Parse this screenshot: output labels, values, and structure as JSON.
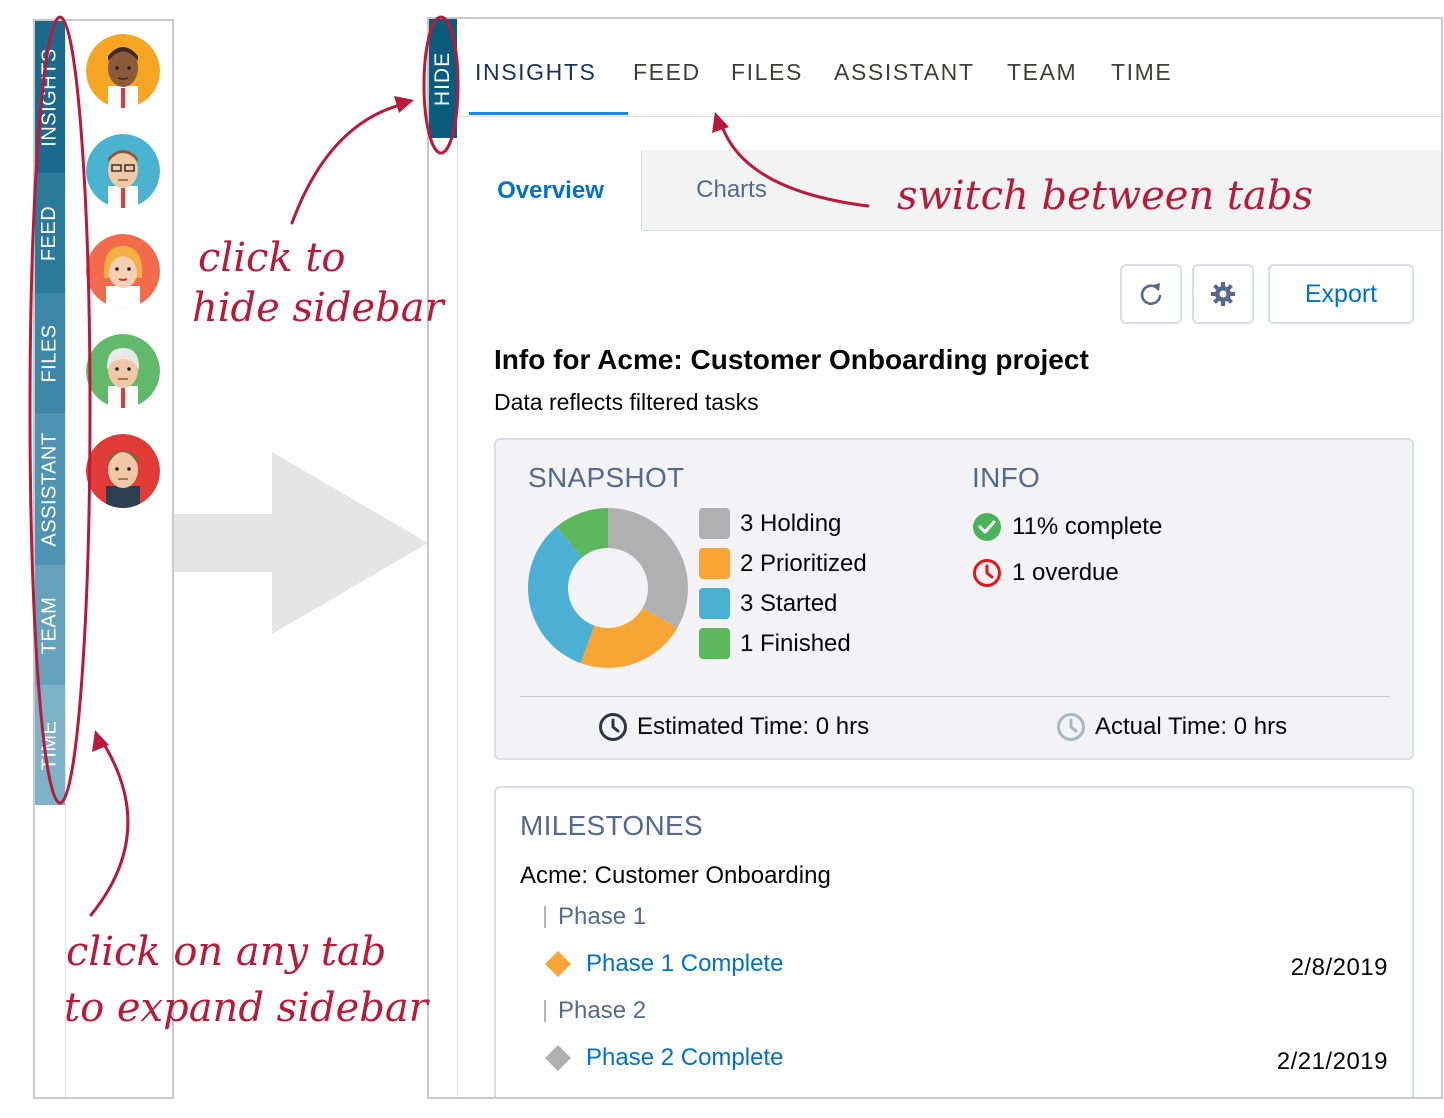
{
  "sidebar_collapsed": {
    "tabs": [
      {
        "label": "INSIGHTS",
        "color": "#1b6a8d"
      },
      {
        "label": "FEED",
        "color": "#2b7a9c"
      },
      {
        "label": "FILES",
        "color": "#3c87a7"
      },
      {
        "label": "ASSISTANT",
        "color": "#4e94b2"
      },
      {
        "label": "TEAM",
        "color": "#65a3bd"
      },
      {
        "label": "TIME",
        "color": "#7db2c8"
      }
    ],
    "avatars": [
      {
        "name": "avatar",
        "bg": "#f6a623",
        "skin": "#8a5a3b",
        "hair": "#3b2a20"
      },
      {
        "name": "avatar",
        "bg": "#4bb3d1",
        "skin": "#f1c9a5",
        "hair": "#8a5a3b"
      },
      {
        "name": "avatar",
        "bg": "#f26b4c",
        "skin": "#f5d0b5",
        "hair": "#f5b041"
      },
      {
        "name": "avatar",
        "bg": "#62b96c",
        "skin": "#f0c8a8",
        "hair": "#e8e8e8"
      },
      {
        "name": "avatar",
        "bg": "#e03b36",
        "skin": "#f0c8a8",
        "hair": "#8b5e3c"
      }
    ]
  },
  "expanded": {
    "hide_label": "HIDE",
    "tabs": [
      "INSIGHTS",
      "FEED",
      "FILES",
      "ASSISTANT",
      "TEAM",
      "TIME"
    ],
    "active_tab": "INSIGHTS",
    "subtabs": {
      "overview": "Overview",
      "charts": "Charts"
    },
    "toolbar": {
      "refresh_icon": "refresh-icon",
      "settings_icon": "gear-icon",
      "export_label": "Export"
    },
    "title": "Info for Acme: Customer Onboarding project",
    "subtitle": "Data reflects filtered tasks",
    "snapshot": {
      "heading": "SNAPSHOT",
      "legend": [
        {
          "label": "3 Holding",
          "color": "#b0b0b0"
        },
        {
          "label": "2 Prioritized",
          "color": "#f7a535"
        },
        {
          "label": "3 Started",
          "color": "#4bb0d3"
        },
        {
          "label": "1 Finished",
          "color": "#5cb85c"
        }
      ]
    },
    "info": {
      "heading": "INFO",
      "complete": "11% complete",
      "overdue": "1 overdue",
      "complete_color": "#4bb25a",
      "overdue_color": "#e5141c"
    },
    "estimated_time": "Estimated Time: 0 hrs",
    "actual_time": "Actual Time: 0 hrs",
    "milestones": {
      "heading": "MILESTONES",
      "project": "Acme: Customer Onboarding",
      "items": [
        {
          "phase": "Phase 1",
          "milestone": "Phase 1 Complete",
          "date": "2/8/2019",
          "marker_color": "#f7a535"
        },
        {
          "phase": "Phase 2",
          "milestone": "Phase 2 Complete",
          "date": "2/21/2019",
          "marker_color": "#b0b0b0"
        }
      ]
    }
  },
  "chart_data": {
    "type": "pie",
    "categories": [
      "Holding",
      "Prioritized",
      "Started",
      "Finished"
    ],
    "values": [
      3,
      2,
      3,
      1
    ],
    "colors": [
      "#b0b0b0",
      "#f7a535",
      "#4bb0d3",
      "#5cb85c"
    ],
    "donut": true
  },
  "annotations": {
    "hide_sidebar": [
      "click to",
      "hide sidebar"
    ],
    "switch_tabs": "switch between tabs",
    "expand_sidebar": [
      "click on any tab",
      "to expand sidebar"
    ],
    "color": "#b81a3a"
  }
}
